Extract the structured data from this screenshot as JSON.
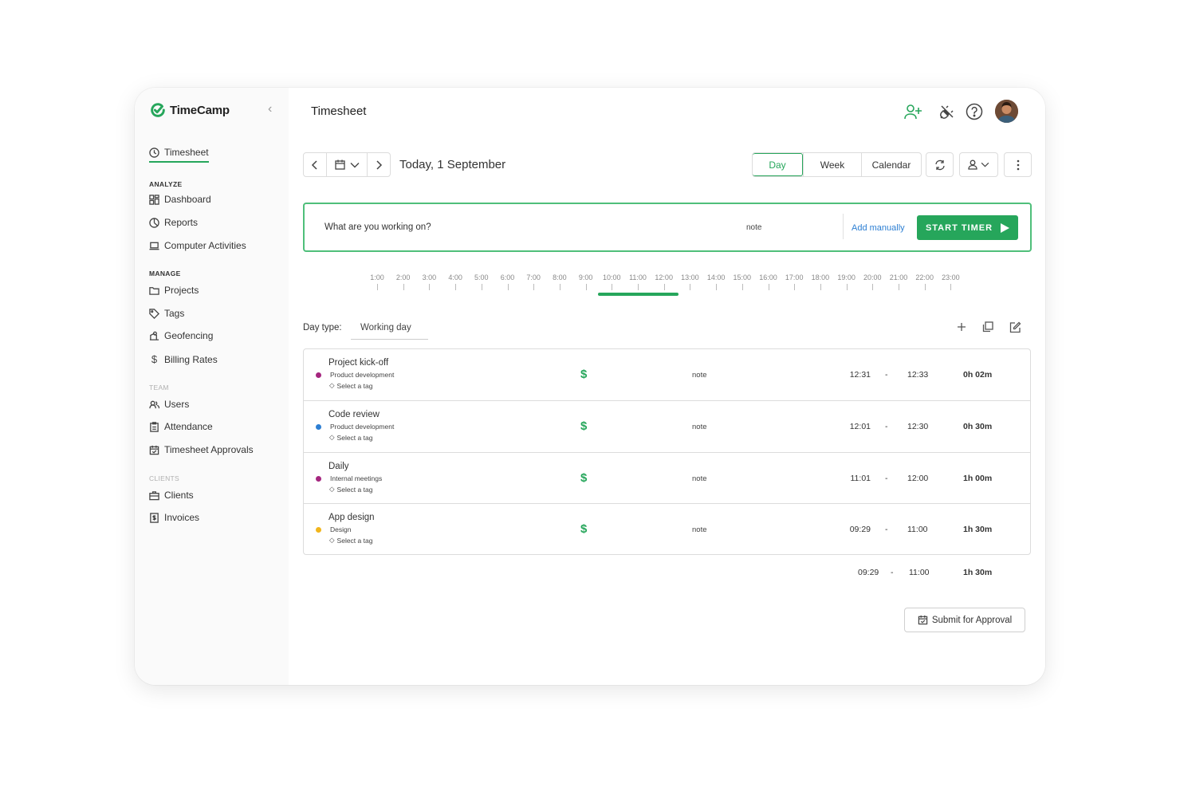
{
  "app": {
    "name": "TimeCamp"
  },
  "sidebar": {
    "timesheet": "Timesheet",
    "sections": {
      "analyze": "ANALYZE",
      "manage": "MANAGE",
      "team": "TEAM",
      "clients": "CLIENTS"
    },
    "items": {
      "dashboard": "Dashboard",
      "reports": "Reports",
      "computer_activities": "Computer Activities",
      "projects": "Projects",
      "tags": "Tags",
      "geofencing": "Geofencing",
      "billing_rates": "Billing Rates",
      "users": "Users",
      "attendance": "Attendance",
      "timesheet_approvals": "Timesheet Approvals",
      "clients": "Clients",
      "invoices": "Invoices"
    }
  },
  "header": {
    "title": "Timesheet"
  },
  "toolbar": {
    "date": "Today, 1 September",
    "views": {
      "day": "Day",
      "week": "Week",
      "calendar": "Calendar"
    },
    "active_view": "Day"
  },
  "timer": {
    "placeholder": "What are you working on?",
    "note": "note",
    "add_manually": "Add manually",
    "start": "START TIMER"
  },
  "timeline": {
    "hours": [
      "1:00",
      "2:00",
      "3:00",
      "4:00",
      "5:00",
      "6:00",
      "7:00",
      "8:00",
      "9:00",
      "10:00",
      "11:00",
      "12:00",
      "13:00",
      "14:00",
      "15:00",
      "16:00",
      "17:00",
      "18:00",
      "19:00",
      "20:00",
      "21:00",
      "22:00",
      "23:00"
    ],
    "tracked_range": [
      "09:29",
      "12:33"
    ]
  },
  "daytype": {
    "label": "Day type:",
    "value": "Working day"
  },
  "entries": [
    {
      "title": "Project kick-off",
      "project": "Product development",
      "tag": "Select a tag",
      "note": "note",
      "start": "12:31",
      "end": "12:33",
      "duration": "0h 02m",
      "color": "#a5267f"
    },
    {
      "title": "Code review",
      "project": "Product development",
      "tag": "Select a tag",
      "note": "note",
      "start": "12:01",
      "end": "12:30",
      "duration": "0h 30m",
      "color": "#2d7fd3"
    },
    {
      "title": "Daily",
      "project": "Internal meetings",
      "tag": "Select a tag",
      "note": "note",
      "start": "11:01",
      "end": "12:00",
      "duration": "1h 00m",
      "color": "#a5267f"
    },
    {
      "title": "App design",
      "project": "Design",
      "tag": "Select a tag",
      "note": "note",
      "start": "09:29",
      "end": "11:00",
      "duration": "1h 30m",
      "color": "#f1b51c"
    }
  ],
  "dash": "-",
  "billable_symbol": "$",
  "totals": {
    "start": "09:29",
    "end": "11:00",
    "duration": "1h 30m"
  },
  "submit": "Submit for Approval",
  "colors": {
    "accent": "#26a65b",
    "link": "#2d7fd3"
  }
}
